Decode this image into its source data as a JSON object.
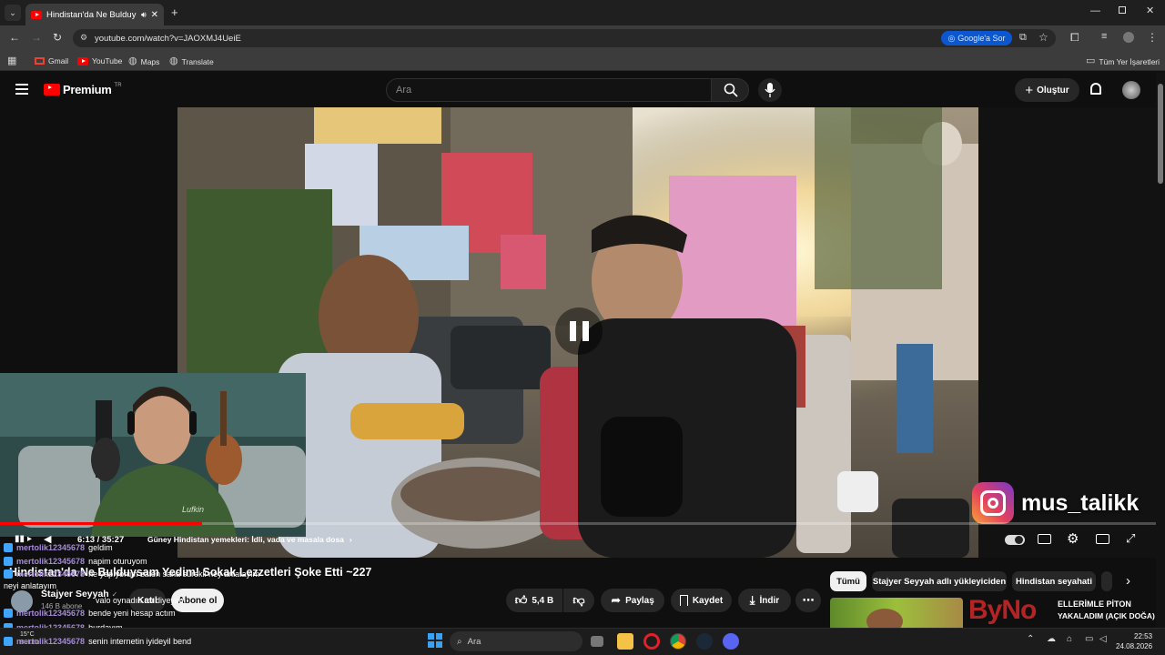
{
  "browser": {
    "tab_title": "Hindistan'da Ne Bulduysam",
    "url": "youtube.com/watch?v=JAOXMJ4UeiE",
    "google_button": "Google'a Sor",
    "bookmarks": [
      {
        "label": "Gmail"
      },
      {
        "label": "YouTube"
      },
      {
        "label": "Maps"
      },
      {
        "label": "Translate"
      }
    ],
    "all_bookmarks": "Tüm Yer İşaretleri"
  },
  "youtube": {
    "logo_text": "Premium",
    "logo_region": "TR",
    "search_placeholder": "Ara",
    "create_label": "Oluştur"
  },
  "video": {
    "instagram_handle": "mus_talikk",
    "time": "6:13 / 35:27",
    "chapter": "Güney Hindistan yemekleri: İdli, vada ve masala dosa",
    "title": "Hindistan'da Ne Bulduysam Yedim! Sokak Lezzetleri Şoke Etti ~227",
    "webcam_shirt": "Lufkin"
  },
  "channel": {
    "name": "Stajyer Seyyah",
    "subscribers": "146 B abone",
    "join_label": "Katıl",
    "subscribe_label": "Abone ol"
  },
  "actions": {
    "likes": "5,4 B",
    "share": "Paylaş",
    "save": "Kaydet",
    "download": "İndir"
  },
  "chips": [
    "Tümü",
    "Stajyer Seyyah adlı yükleyiciden",
    "Hindistan seyahati"
  ],
  "recommended": {
    "title_fragment": "ELLERİMLE PİTON",
    "sub_fragment": "YAKALADIM (AÇIK DOĞA)",
    "watermark": "ByNo"
  },
  "chat": [
    {
      "user": "mertolik12345678",
      "msg": "geldim"
    },
    {
      "user": "mertolik12345678",
      "msg": "napim oturuyom"
    },
    {
      "user": "mertolik12345678",
      "msg": "ne yapıyorum zaten sana sürekli ney anlatayım"
    },
    {
      "user": "",
      "msg": "neyi anlatayım"
    },
    {
      "user": "mertolik12345678",
      "msg": "valo oynadın mı diyeyim"
    },
    {
      "user": "mertolik12345678",
      "msg": "bende yeni hesap actım"
    },
    {
      "user": "mertolik12345678",
      "msg": "burdayım"
    },
    {
      "user": "mertolik12345678",
      "msg": "senin internetin iyideyil bend"
    }
  ],
  "taskbar": {
    "search": "Ara",
    "weather_temp": "15°C",
    "weather_label": "Bulutlu",
    "time": "22:53",
    "date": "24.08.2026"
  },
  "colors": {
    "yt_red": "#ff0000",
    "chat_user": "#a58bd9",
    "chat_icon": "#3ea6ff",
    "chip_active": "#f1f1f1"
  }
}
